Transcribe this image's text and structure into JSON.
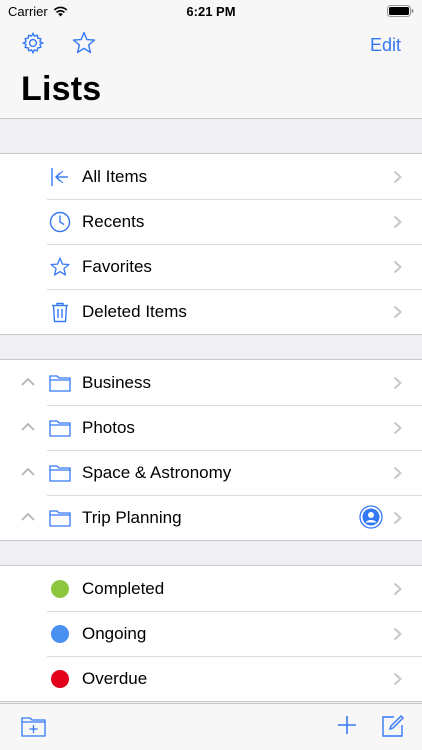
{
  "status": {
    "carrier": "Carrier",
    "time": "6:21 PM"
  },
  "nav": {
    "settings_icon": "gear-icon",
    "favorites_icon": "star-icon",
    "edit_label": "Edit",
    "title": "Lists"
  },
  "smart_lists": [
    {
      "label": "All Items",
      "icon": "inbox-arrow-icon"
    },
    {
      "label": "Recents",
      "icon": "clock-icon"
    },
    {
      "label": "Favorites",
      "icon": "star-icon"
    },
    {
      "label": "Deleted Items",
      "icon": "trash-icon"
    }
  ],
  "folders": [
    {
      "label": "Business",
      "shared": false
    },
    {
      "label": "Photos",
      "shared": false
    },
    {
      "label": "Space & Astronomy",
      "shared": false
    },
    {
      "label": "Trip Planning",
      "shared": true
    }
  ],
  "statuses": [
    {
      "label": "Completed",
      "color": "#8dc63f"
    },
    {
      "label": "Ongoing",
      "color": "#4a90f0"
    },
    {
      "label": "Overdue",
      "color": "#e3001b"
    }
  ],
  "toolbar": {
    "new_folder_icon": "folder-plus-icon",
    "add_icon": "plus-icon",
    "compose_icon": "compose-icon"
  },
  "colors": {
    "accent": "#3478f6",
    "chevron": "#c7c7cc"
  }
}
